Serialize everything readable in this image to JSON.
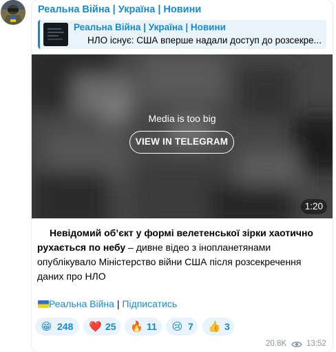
{
  "channel": {
    "name": "Реальна Війна | Україна | Новини"
  },
  "reply": {
    "title": "Реальна Війна | Україна | Новини",
    "text": "НЛО існує: США вперше надали доступ до розсекре..."
  },
  "media": {
    "message": "Media is too big",
    "button_label": "VIEW IN TELEGRAM",
    "duration": "1:20"
  },
  "post": {
    "bold_text": "Невідомий об’єкт у формі велетенської зірки хаотично рухається по небу",
    "rest_text": " – дивне відео з інопланетянами опублікувало Міністерство війни США після розсекречення даних про НЛО"
  },
  "footer": {
    "channel_link": "Реальна Війна",
    "separator": " | ",
    "subscribe_link": "Підписатись"
  },
  "reactions": [
    {
      "emoji": "😁",
      "count": "248"
    },
    {
      "emoji": "❤️",
      "count": "25"
    },
    {
      "emoji": "🔥",
      "count": "11"
    },
    {
      "emoji": "😢",
      "count": "7"
    },
    {
      "emoji": "👍",
      "count": "3"
    }
  ],
  "meta": {
    "views": "20.8K",
    "time": "13:52"
  },
  "colors": {
    "accent": "#168acd",
    "reply_bg": "#e8f3fb",
    "meta": "#8a959e"
  }
}
